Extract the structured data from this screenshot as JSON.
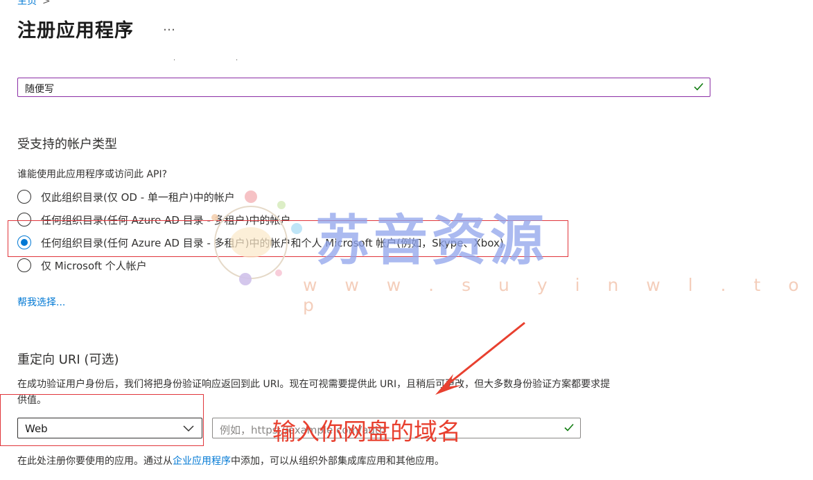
{
  "breadcrumb": {
    "home": "主页",
    "sep": ">"
  },
  "page": {
    "title": "注册应用程序",
    "more": "…"
  },
  "name_field": {
    "value": "随便写",
    "valid_icon": "check-icon"
  },
  "account_types": {
    "heading": "受支持的帐户类型",
    "question": "谁能使用此应用程序或访问此 API?",
    "options": [
      {
        "label": "仅此组织目录(仅 OD - 单一租户)中的帐户",
        "selected": false
      },
      {
        "label": "任何组织目录(任何 Azure AD 目录 - 多租户)中的帐户",
        "selected": false
      },
      {
        "label": "任何组织目录(任何 Azure AD 目录 - 多租户)中的帐户和个人 Microsoft 帐户(例如，Skype、Xbox)",
        "selected": true
      },
      {
        "label": "仅 Microsoft 个人帐户",
        "selected": false
      }
    ],
    "help_link": "帮我选择..."
  },
  "redirect": {
    "heading": "重定向 URI (可选)",
    "desc_line1": "在成功验证用户身份后，我们将把身份验证响应返回到此 URI。现在可视需要提供此 URI，且稍后可更改，但大多数身份验证方案都要求提",
    "desc_line2": "供值。",
    "platform": "Web",
    "uri_placeholder": "例如，https://example.com/auth"
  },
  "footer": {
    "before": "在此处注册你要使用的应用。通过从",
    "link": "企业应用程序",
    "after": "中添加，可以从组织外部集成库应用和其他应用。"
  },
  "watermark": {
    "text": "苏音资源",
    "url": "w w w . s u y i n w l . t o p"
  },
  "annotation": {
    "text": "输入你网盘的域名"
  },
  "colors": {
    "accent": "#0078d4",
    "valid": "#107c10",
    "annotation": "#e8402f",
    "focus_border": "#8a2da5"
  }
}
